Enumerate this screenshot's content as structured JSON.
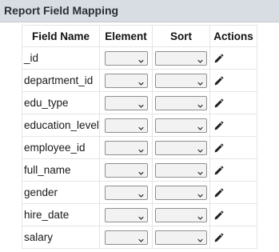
{
  "panel": {
    "title": "Report Field Mapping"
  },
  "table": {
    "headers": {
      "field_name": "Field Name",
      "element": "Element",
      "sort": "Sort",
      "actions": "Actions"
    },
    "rows": [
      {
        "field": "_id",
        "element": "",
        "sort": ""
      },
      {
        "field": "department_id",
        "element": "",
        "sort": ""
      },
      {
        "field": "edu_type",
        "element": "",
        "sort": ""
      },
      {
        "field": "education_level",
        "element": "",
        "sort": ""
      },
      {
        "field": "employee_id",
        "element": "",
        "sort": ""
      },
      {
        "field": "full_name",
        "element": "",
        "sort": ""
      },
      {
        "field": "gender",
        "element": "",
        "sort": ""
      },
      {
        "field": "hire_date",
        "element": "",
        "sort": ""
      },
      {
        "field": "salary",
        "element": "",
        "sort": ""
      }
    ],
    "row_action_icon": "pencil-icon",
    "select_icon": "chevron-down-icon"
  }
}
